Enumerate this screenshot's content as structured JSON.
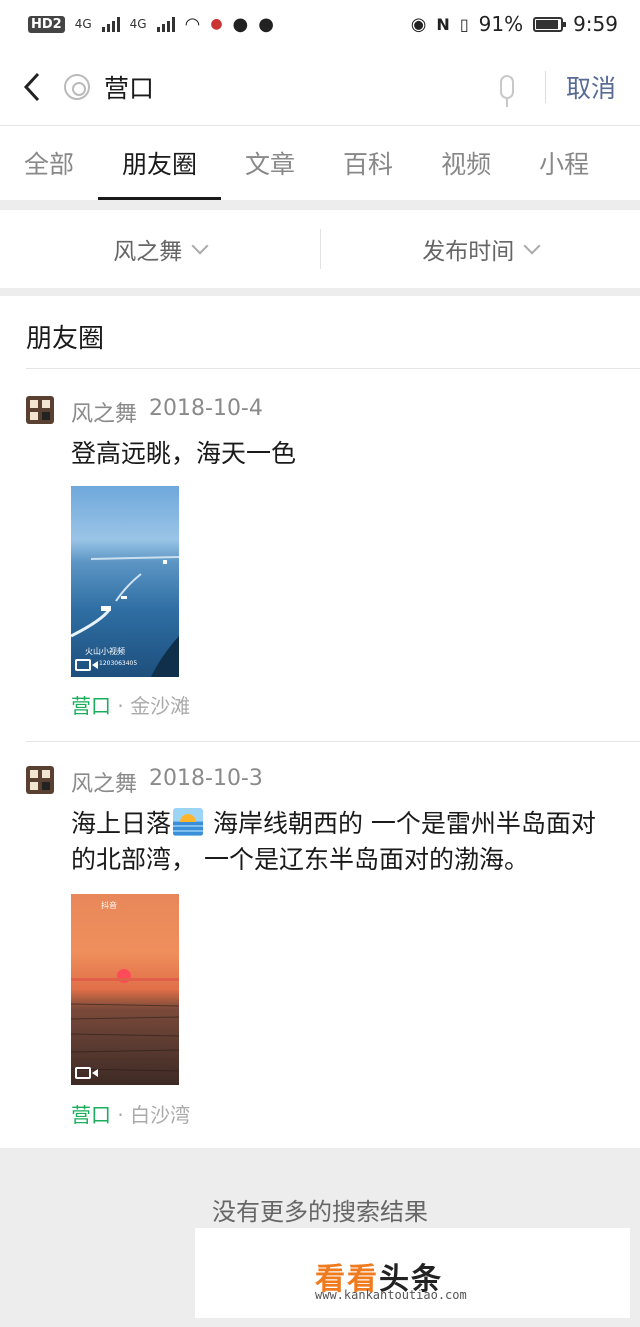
{
  "status_bar": {
    "left_chip": "HD",
    "left_chip_sub": "2",
    "net1": "4G",
    "net2": "4G",
    "battery": "91%",
    "time": "9:59"
  },
  "search": {
    "query": "营口",
    "cancel_label": "取消"
  },
  "tabs": [
    "全部",
    "朋友圈",
    "文章",
    "百科",
    "视频",
    "小程"
  ],
  "active_tab": "朋友圈",
  "filters": {
    "author": "风之舞",
    "time": "发布时间"
  },
  "section_title": "朋友圈",
  "posts": [
    {
      "author": "风之舞",
      "date": "2018-10-4",
      "text": "登高远眺，海天一色",
      "thumb_overlay": "火山小视频",
      "thumb_id": "1203063405",
      "location_name": "营口",
      "location_detail": "金沙滩"
    },
    {
      "author": "风之舞",
      "date": "2018-10-3",
      "text_before": "海上日落",
      "text_after": " 海岸线朝西的 一个是雷州半岛面对的北部湾， 一个是辽东半岛面对的渤海。",
      "thumb_overlay": "抖音",
      "location_name": "营口",
      "location_detail": "白沙湾"
    }
  ],
  "location_separator": "·",
  "footer": {
    "no_more": "没有更多的搜索结果",
    "wm_orange": "看看",
    "wm_dark": "头条",
    "wm_url": "www.kankantoutiao.com"
  },
  "colors": {
    "link_blue": "#576b95",
    "location_green": "#1aad5b",
    "band_gray": "#ededed"
  },
  "icons": [
    "back-arrow-icon",
    "shutter-icon",
    "mic-icon",
    "chevron-down-icon",
    "video-icon",
    "sunrise-emoji-icon"
  ]
}
